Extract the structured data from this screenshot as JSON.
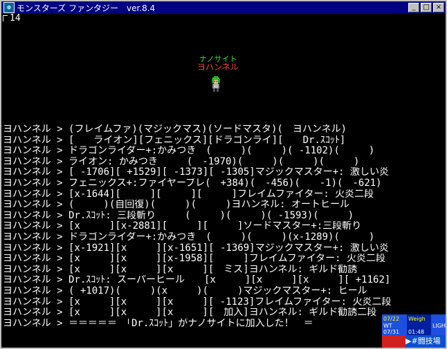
{
  "window": {
    "title": "モンスターズ ファンタジー　ver.8.4",
    "app_icon": "globe-icon",
    "controls": {
      "minimize": "_",
      "maximize": "□",
      "close": "×"
    }
  },
  "status": {
    "counter": "14"
  },
  "party": {
    "monster_name": "ナノサイト",
    "player_name": "ヨハンネル"
  },
  "log": [
    "ヨハンネル > (フレイムファ)(マジックマス)(ソードマスタ)(　ヨハンネル)",
    "ヨハンネル > [　　ライオン][フェニックス][ドラゴンライ][　　Dr.ｽｺｯﾄ]",
    "ヨハンネル > ドラゴンライダー+:かみつき　(　　　)(　　　)( -1102)(　　　)",
    "ヨハンネル > ライオン: かみつき　　　(　-1970)(　　　)(　　　)(　　　)",
    "ヨハンネル > [ -1706][ +1529][ -1373][ -1305]マジックマスター+: 激しい炎",
    "ヨハンネル > フェニックス+:ファイヤーブレ(　+384)(　-456)(　　-1)(　-621)",
    "ヨハンネル > [x-1644][　　　][　　　][　　　]フレイムファイター: 火炎二段",
    "ヨハンネル > (　　　)(自回復)(　　　)(　　　)ヨハンネル: オートヒール",
    "ヨハンネル > Dr.ｽｺｯﾄ: 三段斬り　　　(　　　)(　　　)( -1593)(　　　)",
    "ヨハンネル > [x　　　][x-2881][　　　][　　　]ソードマスター+:三段斬り",
    "ヨハンネル > ドラゴンライダー+:かみつき　(　　　)(　　　)(x-1289)(　　　)",
    "ヨハンネル > [x-1921][x　　　][x-1651][ -1369]マジックマスター+: 激しい炎",
    "ヨハンネル > [x　　　][x　　　][x-1958][　　　]フレイムファイター: 火炎二段",
    "ヨハンネル > [x　　　][x　　　][x　　　][　ミス]ヨハンネル: ギルド勧誘",
    "ヨハンネル > Dr.ｽｺｯﾄ: スーパーヒール　　[x　　　][x　　　][x　　　][ +1162]",
    "ヨハンネル > ( +1017)(　　　)(x　　　)(　　　)マジックマスター+: ヒール",
    "ヨハンネル > [x　　　][x　　　][x　　　][ -1123]フレイムファイター: 火炎二段",
    "ヨハンネル > [x　　　][x　　　][x　　　][　加入]ヨハンネル: ギルド勧誘二段",
    "ヨハンネル > ＝＝＝＝＝　「Dr.ｽｺｯﾄ」がナノサイトに加入した！　＝"
  ],
  "widget": {
    "date_top": "07/22",
    "weight_label": "Weigh",
    "tab_label": "WT",
    "date_bottom": "07/31",
    "time": "01:48",
    "channel": "#闘技場",
    "vertical_text": "LIGHT"
  },
  "colors": {
    "titlebar": "#000080",
    "monster_name": "#30e030",
    "player_name": "#ff4040",
    "log_text": "#ffffff",
    "background": "#000000"
  }
}
